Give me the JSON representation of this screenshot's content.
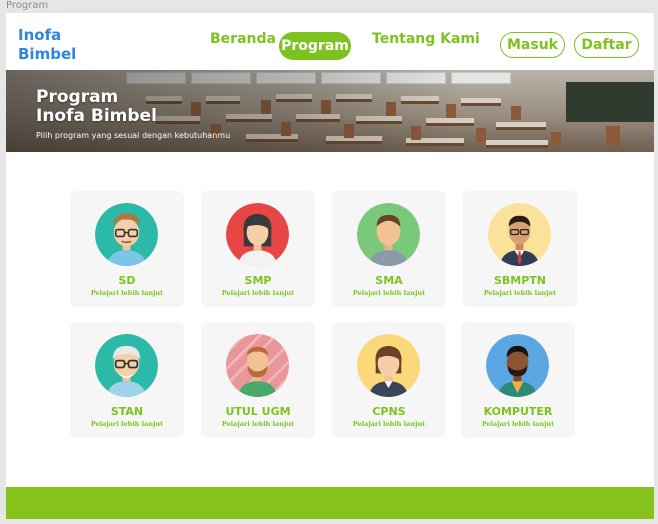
{
  "window": {
    "title": "Program"
  },
  "nav": {
    "logo_line1": "Inofa",
    "logo_line2": "Bimbel",
    "beranda": "Beranda",
    "program": "Program",
    "tentang": "Tentang Kami",
    "masuk": "Masuk",
    "daftar": "Daftar"
  },
  "hero": {
    "title_line1": "Program",
    "title_line2": "Inofa Bimbel",
    "subtitle": "Pilih program yang sesuai dengan kebutuhanmu"
  },
  "programs": [
    {
      "title": "SD",
      "link": "Pelajari lebih lanjut",
      "avatar_bg": "#2bb9a8"
    },
    {
      "title": "SMP",
      "link": "Pelajari lebih lanjut",
      "avatar_bg": "#e84545"
    },
    {
      "title": "SMA",
      "link": "Pelajari lebih lanjut",
      "avatar_bg": "#7ac97a"
    },
    {
      "title": "SBMPTN",
      "link": "Pelajari lebih lanjut",
      "avatar_bg": "#fbe29a"
    },
    {
      "title": "STAN",
      "link": "Pelajari lebih lanjut",
      "avatar_bg": "#2bb9a8"
    },
    {
      "title": "UTUL UGM",
      "link": "Pelajari lebih lanjut",
      "avatar_bg": "#e8969a"
    },
    {
      "title": "CPNS",
      "link": "Pelajari lebih lanjut",
      "avatar_bg": "#fbd97a"
    },
    {
      "title": "KOMPUTER",
      "link": "Pelajari lebih lanjut",
      "avatar_bg": "#5ba7e3"
    }
  ],
  "colors": {
    "accent_green": "#7cc31f",
    "logo_blue": "#2e86de",
    "footer_green": "#86c41d"
  }
}
